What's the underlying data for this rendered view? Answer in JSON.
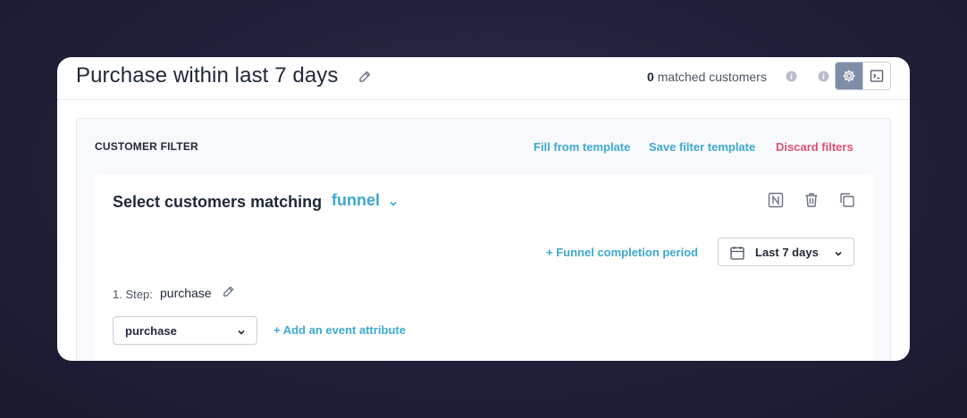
{
  "header": {
    "title": "Purchase within last 7 days",
    "matched_count": "0",
    "matched_label": "matched customers",
    "icons": [
      "edit-pencil-icon",
      "info-icon",
      "settings-cog-icon",
      "terminal-icon"
    ]
  },
  "filter": {
    "title": "CUSTOMER FILTER",
    "fill_template": "Fill from template",
    "save_template": "Save filter template",
    "discard": "Discard filters"
  },
  "condition": {
    "label": "Select customers matching",
    "type": "funnel",
    "actions": [
      "notation-icon",
      "trash-icon",
      "copy-icon"
    ]
  },
  "funnel": {
    "completion_link": "+ Funnel completion period",
    "period": "Last 7 days"
  },
  "step": {
    "label": "1. Step:",
    "name": "purchase",
    "event": "purchase",
    "add_attribute": "+ Add an event attribute"
  },
  "colors": {
    "accent": "#3ea8d1",
    "danger": "#e0506e",
    "toggle_active": "#7f8ea8",
    "text_dark": "#1f2937"
  }
}
